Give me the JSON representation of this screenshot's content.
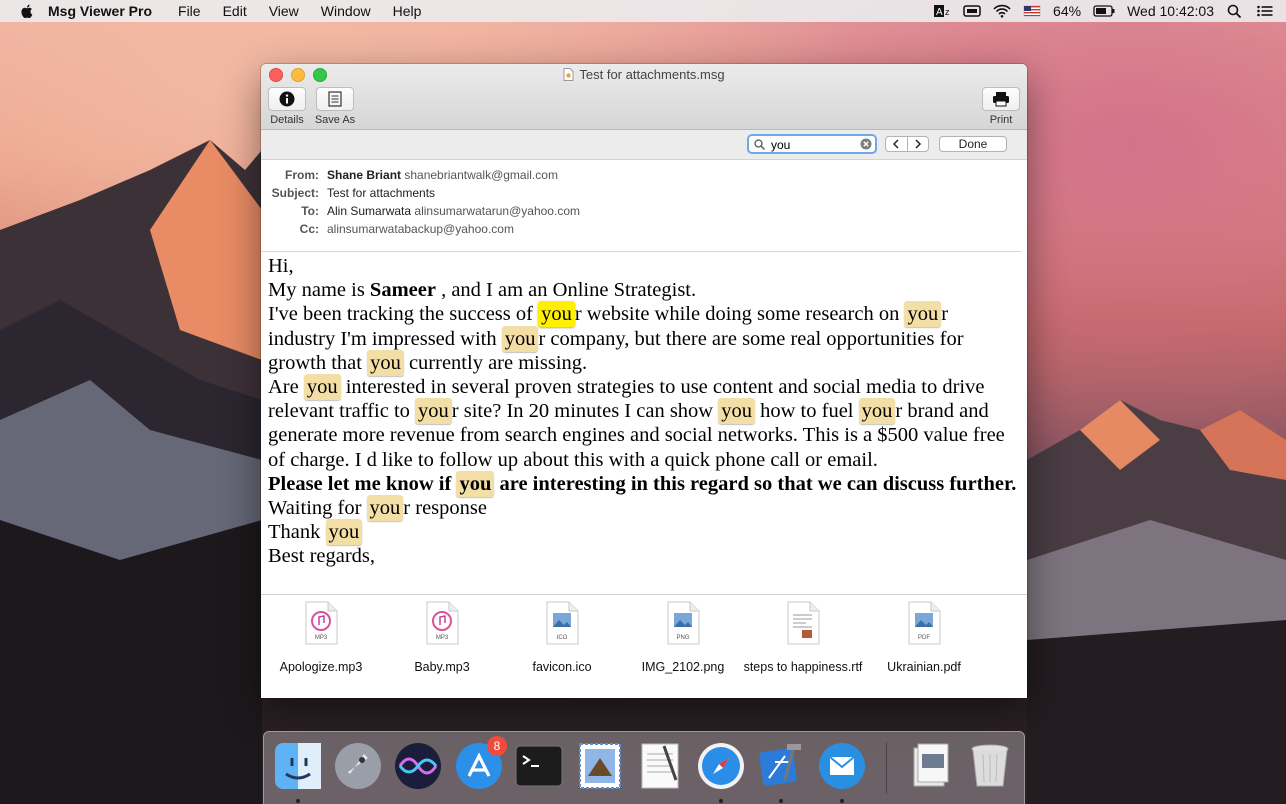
{
  "menubar": {
    "app_name": "Msg Viewer Pro",
    "menus": [
      "File",
      "Edit",
      "View",
      "Window",
      "Help"
    ],
    "battery": "64%",
    "clock": "Wed 10:42:03"
  },
  "window": {
    "title": "Test for attachments.msg",
    "toolbar": {
      "details_label": "Details",
      "save_as_label": "Save As",
      "print_label": "Print"
    },
    "find": {
      "query": "you",
      "done_label": "Done"
    },
    "header": {
      "from_label": "From:",
      "from_name": "Shane Briant",
      "from_email": "shanebriantwalk@gmail.com",
      "subject_label": "Subject:",
      "subject": "Test for attachments",
      "to_label": "To:",
      "to_name": "Alin Sumarwata",
      "to_email": "alinsumarwatarun@yahoo.com",
      "cc_label": "Cc:",
      "cc_email": "alinsumarwatabackup@yahoo.com"
    },
    "body": {
      "greeting": "Hi,",
      "intro_pre": "My name is ",
      "intro_name": "Sameer",
      "intro_post": " , and I am an Online Strategist.",
      "p1_a": "I've been tracking the success of ",
      "p1_b": "r website while doing some research on ",
      "p1_c": "r industry I'm impressed with ",
      "p1_d": "r company, but there are some real opportunities for growth that ",
      "p1_e": " currently are missing.",
      "p2_a": "Are ",
      "p2_b": " interested in several proven strategies to use content and social media to drive relevant traffic to ",
      "p2_c": "r site? In 20 minutes I can show ",
      "p2_d": " how to fuel ",
      "p2_e": "r brand and generate more revenue from search engines and social networks. This is a $500 value free of charge. I d like to follow up about this with a quick phone call or email.",
      "p3_a": "Please let me know if ",
      "p3_b": " are interesting in this regard so that we can discuss further.",
      "p4_a": "Waiting for ",
      "p4_b": "r response",
      "p5_a": "Thank ",
      "closing": "Best regards,",
      "match": "you"
    },
    "attachments": [
      {
        "name": "Apologize.mp3",
        "type": "MP3",
        "icon": "music-file-icon"
      },
      {
        "name": "Baby.mp3",
        "type": "MP3",
        "icon": "music-file-icon"
      },
      {
        "name": "favicon.ico",
        "type": "ICO",
        "icon": "image-file-icon"
      },
      {
        "name": "IMG_2102.png",
        "type": "PNG",
        "icon": "image-file-icon"
      },
      {
        "name": "steps to happiness.rtf",
        "type": "",
        "icon": "rtf-file-icon"
      },
      {
        "name": "Ukrainian.pdf",
        "type": "PDF",
        "icon": "pdf-file-icon"
      }
    ]
  },
  "dock": {
    "apps": [
      "Finder",
      "Launchpad",
      "Siri",
      "App Store",
      "Terminal",
      "Mail",
      "TextEdit",
      "Safari",
      "Xcode",
      "Msg Viewer Pro",
      "Preview",
      "Trash"
    ],
    "app_store_badge": "8"
  },
  "colors": {
    "highlight": "#f3dfa6",
    "current_highlight": "#ffef00",
    "search_focus": "#6fa6ee"
  }
}
